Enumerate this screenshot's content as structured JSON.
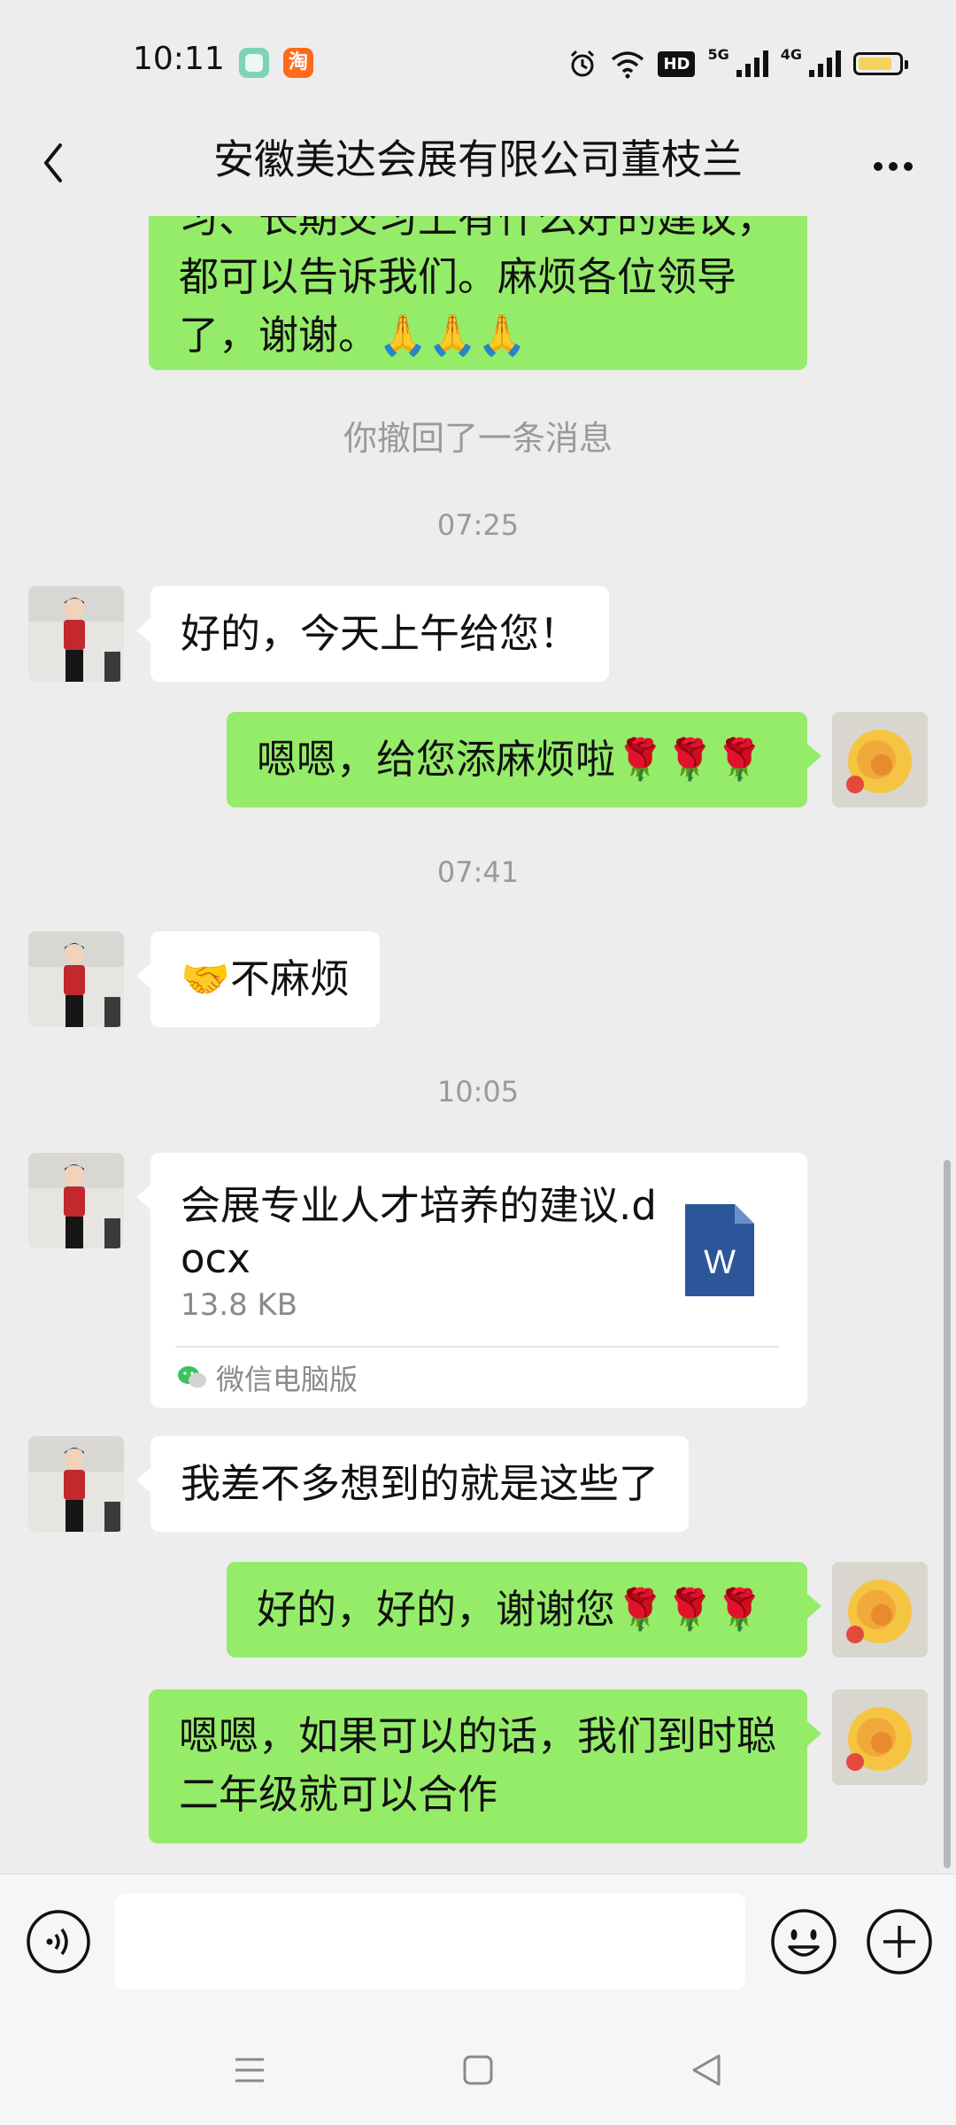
{
  "status_bar": {
    "time": "10:11",
    "notifications": [
      {
        "icon": "app-notification-icon",
        "label": "",
        "color": "#7dd3b8"
      },
      {
        "icon": "taobao-icon",
        "label": "淘",
        "color": "#ff6a1a"
      }
    ],
    "hd_label": "HD",
    "network_labels": [
      "5G",
      "4G"
    ],
    "battery_level": 0.85,
    "battery_color": "#f2d45c"
  },
  "header": {
    "title": "安徽美达会展有限公司董枝兰",
    "back_icon": "chevron-left-icon",
    "more_icon": "more-dots-icon"
  },
  "colors": {
    "chat_background": "#ededed",
    "sent_bubble": "#95ec69",
    "received_bubble": "#ffffff",
    "word_icon": "#2b579a"
  },
  "messages": {
    "m0_lines": [
      "习、长期交习上有什么好的建议，",
      "都可以告诉我们。麻烦各位领导",
      "了，谢谢。🙏🙏🙏"
    ],
    "recalled": "你撤回了一条消息",
    "ts1": "07:25",
    "m1": "好的，今天上午给您！",
    "m2": "嗯嗯，给您添麻烦啦🌹🌹🌹",
    "ts2": "07:41",
    "m3": "🤝不麻烦",
    "ts3": "10:05",
    "file": {
      "name": "会展专业人才培养的建议.docx",
      "size": "13.8 KB",
      "icon_letter": "W",
      "source": "微信电脑版"
    },
    "m4": "我差不多想到的就是这些了",
    "m5": "好的，好的，谢谢您🌹🌹🌹",
    "m6_lines": [
      "嗯嗯，如果可以的话，我们到时聪",
      "二年级就可以合作"
    ]
  },
  "input_bar": {
    "placeholder": "",
    "voice_icon": "voice-icon",
    "emoji_icon": "emoji-icon",
    "plus_icon": "plus-icon"
  },
  "system_nav": {
    "icons": [
      "menu-icon",
      "home-icon",
      "back-triangle-icon"
    ]
  }
}
